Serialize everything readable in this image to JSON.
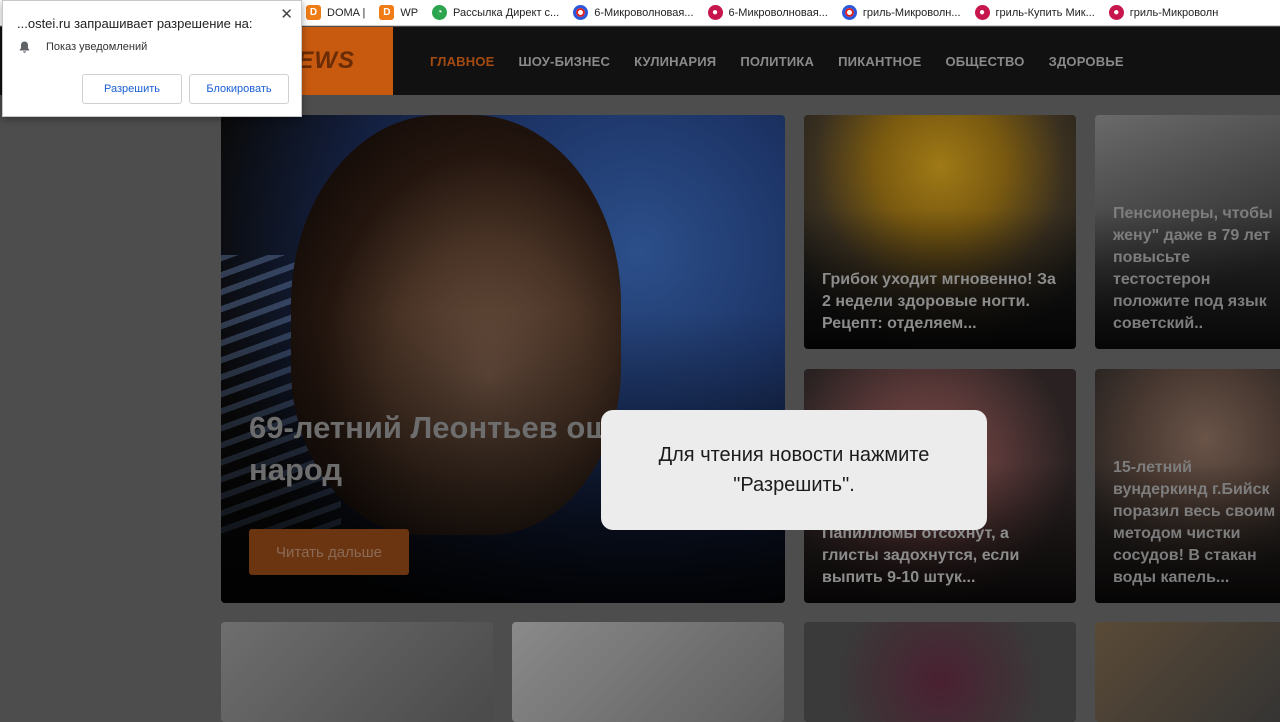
{
  "bookmarks": [
    {
      "label": "DOMA |",
      "icon": "d-icon"
    },
    {
      "label": "WP",
      "icon": "d-icon"
    },
    {
      "label": "Рассылка Директ с...",
      "icon": "green-icon"
    },
    {
      "label": "6-Микроволновая...",
      "icon": "ring-icon"
    },
    {
      "label": "6-Микроволновая...",
      "icon": "lg-icon"
    },
    {
      "label": "гриль-Микроволн...",
      "icon": "ring-icon"
    },
    {
      "label": "гриль-Купить Мик...",
      "icon": "lg-icon"
    },
    {
      "label": "гриль-Микроволн",
      "icon": "lg-icon"
    }
  ],
  "header": {
    "logo": "NEWS",
    "nav": [
      "ГЛАВНОЕ",
      "ШОУ-БИЗНЕС",
      "КУЛИНАРИЯ",
      "ПОЛИТИКА",
      "ПИКАНТНОЕ",
      "ОБЩЕСТВО",
      "ЗДОРОВЬЕ"
    ]
  },
  "hero": {
    "title": "69-летний Леонтьев ошарашил народ",
    "button": "Читать дальше"
  },
  "cards": [
    {
      "title": "Грибок уходит мгновенно! За 2 недели здоровые ногти. Рецепт: отделяем..."
    },
    {
      "title": "Пенсионеры, чтобы жену\" даже в 79 лет повысьте тестостерон положите под язык советский.."
    },
    {
      "title": "Папилломы отсохнут, а глисты задохнутся, если выпить 9-10 штук..."
    },
    {
      "title": "15-летний вундеркинд г.Бийск поразил весь своим методом чистки сосудов! В стакан воды капель..."
    }
  ],
  "permission": {
    "title": "...ostei.ru запрашивает разрешение на:",
    "item": "Показ уведомлений",
    "allow": "Разрешить",
    "block": "Блокировать",
    "close": "✕"
  },
  "overlay": {
    "message": "Для чтения новости нажмите \"Разрешить\"."
  },
  "colors": {
    "accent": "#c85a10",
    "link_blue": "#1a5fd6"
  }
}
